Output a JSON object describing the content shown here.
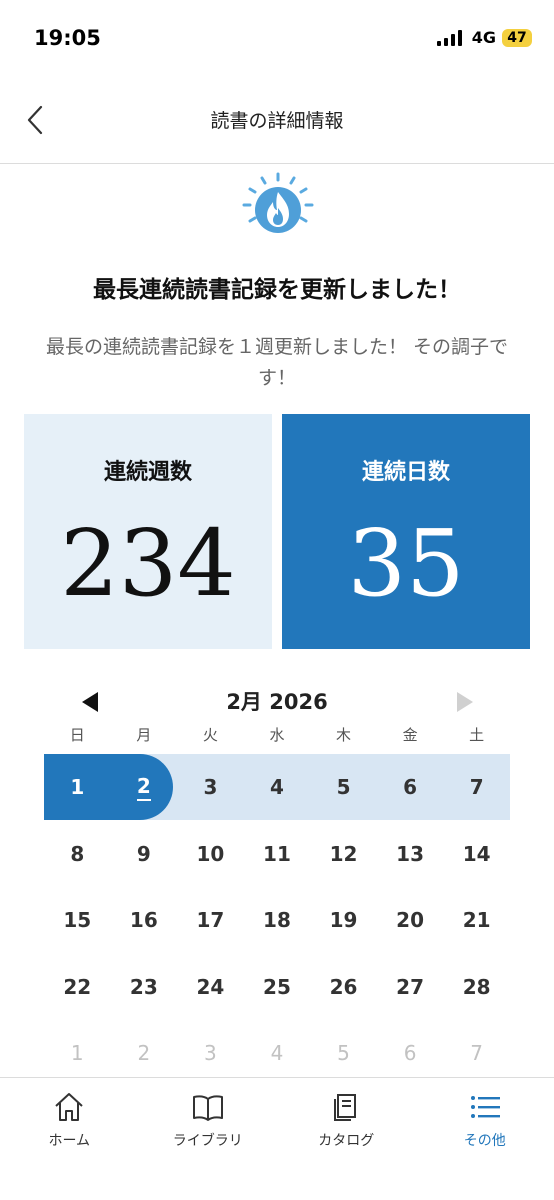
{
  "status_bar": {
    "time": "19:05",
    "network": "4G",
    "battery": "47"
  },
  "header": {
    "title": "読書の詳細情報"
  },
  "hero": {
    "headline": "最長連続読書記録を更新しました！",
    "subtext": "最長の連続読書記録を１週更新しました！ その調子です！"
  },
  "stats": {
    "weeks": {
      "label": "連続週数",
      "value": "234"
    },
    "days": {
      "label": "連続日数",
      "value": "35"
    }
  },
  "calendar": {
    "month_label": "2月 2026",
    "weekdays": [
      "日",
      "月",
      "火",
      "水",
      "木",
      "金",
      "土"
    ],
    "weeks": [
      [
        "1",
        "2",
        "3",
        "4",
        "5",
        "6",
        "7"
      ],
      [
        "8",
        "9",
        "10",
        "11",
        "12",
        "13",
        "14"
      ],
      [
        "15",
        "16",
        "17",
        "18",
        "19",
        "20",
        "21"
      ],
      [
        "22",
        "23",
        "24",
        "25",
        "26",
        "27",
        "28"
      ],
      [
        "1",
        "2",
        "3",
        "4",
        "5",
        "6",
        "7"
      ]
    ],
    "streak_days": [
      "1",
      "2"
    ],
    "today": "2"
  },
  "bottom_nav": [
    {
      "label": "ホーム",
      "icon": "home-icon"
    },
    {
      "label": "ライブラリ",
      "icon": "book-icon"
    },
    {
      "label": "カタログ",
      "icon": "catalog-icon"
    },
    {
      "label": "その他",
      "icon": "list-icon"
    }
  ],
  "colors": {
    "accent": "#2277bb",
    "card_light": "#e6f0f8",
    "week_band": "#d8e6f3"
  }
}
